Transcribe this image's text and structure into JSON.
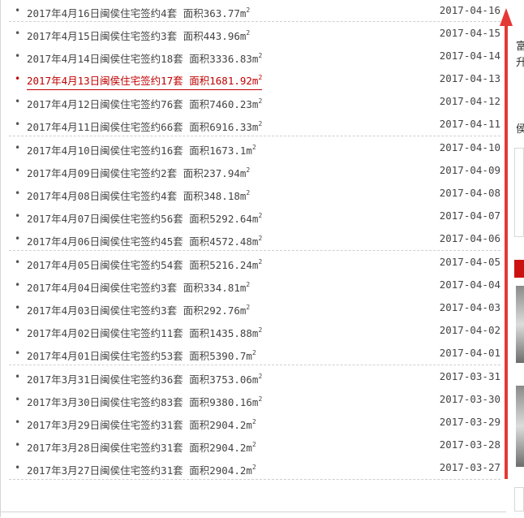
{
  "list": {
    "groups": [
      [
        {
          "title": "2017年4月16日闽侯住宅签约4套 面积363.77m",
          "sup": "2",
          "date": "2017-04-16"
        }
      ],
      [
        {
          "title": "2017年4月15日闽侯住宅签约3套 面积443.96m",
          "sup": "2",
          "date": "2017-04-15"
        },
        {
          "title": "2017年4月14日闽侯住宅签约18套 面积3336.83m",
          "sup": "2",
          "date": "2017-04-14"
        },
        {
          "title": "2017年4月13日闽侯住宅签约17套 面积1681.92m",
          "sup": "2",
          "date": "2017-04-13",
          "active": true
        },
        {
          "title": "2017年4月12日闽侯住宅签约76套 面积7460.23m",
          "sup": "2",
          "date": "2017-04-12"
        },
        {
          "title": "2017年4月11日闽侯住宅签约66套 面积6916.33m",
          "sup": "2",
          "date": "2017-04-11"
        }
      ],
      [
        {
          "title": "2017年4月10日闽侯住宅签约16套 面积1673.1m",
          "sup": "2",
          "date": "2017-04-10"
        },
        {
          "title": "2017年4月09日闽侯住宅签约2套 面积237.94m",
          "sup": "2",
          "date": "2017-04-09"
        },
        {
          "title": "2017年4月08日闽侯住宅签约4套 面积348.18m",
          "sup": "2",
          "date": "2017-04-08"
        },
        {
          "title": "2017年4月07日闽侯住宅签约56套 面积5292.64m",
          "sup": "2",
          "date": "2017-04-07"
        },
        {
          "title": "2017年4月06日闽侯住宅签约45套 面积4572.48m",
          "sup": "2",
          "date": "2017-04-06"
        }
      ],
      [
        {
          "title": "2017年4月05日闽侯住宅签约54套 面积5216.24m",
          "sup": "2",
          "date": "2017-04-05"
        },
        {
          "title": "2017年4月04日闽侯住宅签约3套 面积334.81m",
          "sup": "2",
          "date": "2017-04-04"
        },
        {
          "title": "2017年4月03日闽侯住宅签约3套 面积292.76m",
          "sup": "2",
          "date": "2017-04-03"
        },
        {
          "title": "2017年4月02日闽侯住宅签约11套 面积1435.88m",
          "sup": "2",
          "date": "2017-04-02"
        },
        {
          "title": "2017年4月01日闽侯住宅签约53套 面积5390.7m",
          "sup": "2",
          "date": "2017-04-01"
        }
      ],
      [
        {
          "title": "2017年3月31日闽侯住宅签约36套 面积3753.06m",
          "sup": "2",
          "date": "2017-03-31"
        },
        {
          "title": "2017年3月30日闽侯住宅签约83套 面积9380.16m",
          "sup": "2",
          "date": "2017-03-30"
        },
        {
          "title": "2017年3月29日闽侯住宅签约31套 面积2904.2m",
          "sup": "2",
          "date": "2017-03-29"
        },
        {
          "title": "2017年3月28日闽侯住宅签约31套 面积2904.2m",
          "sup": "2",
          "date": "2017-03-28"
        },
        {
          "title": "2017年3月27日闽侯住宅签约31套 面积2904.2m",
          "sup": "2",
          "date": "2017-03-27"
        }
      ]
    ],
    "bullet": "•"
  },
  "right_panel": {
    "chars": [
      "富",
      "升",
      "侯"
    ]
  },
  "colors": {
    "text": "#444444",
    "active": "#c00000",
    "arrow": "#e53935",
    "divider": "#cfcfcf"
  },
  "icons": {
    "scroll_arrow": "up-arrow-icon"
  }
}
